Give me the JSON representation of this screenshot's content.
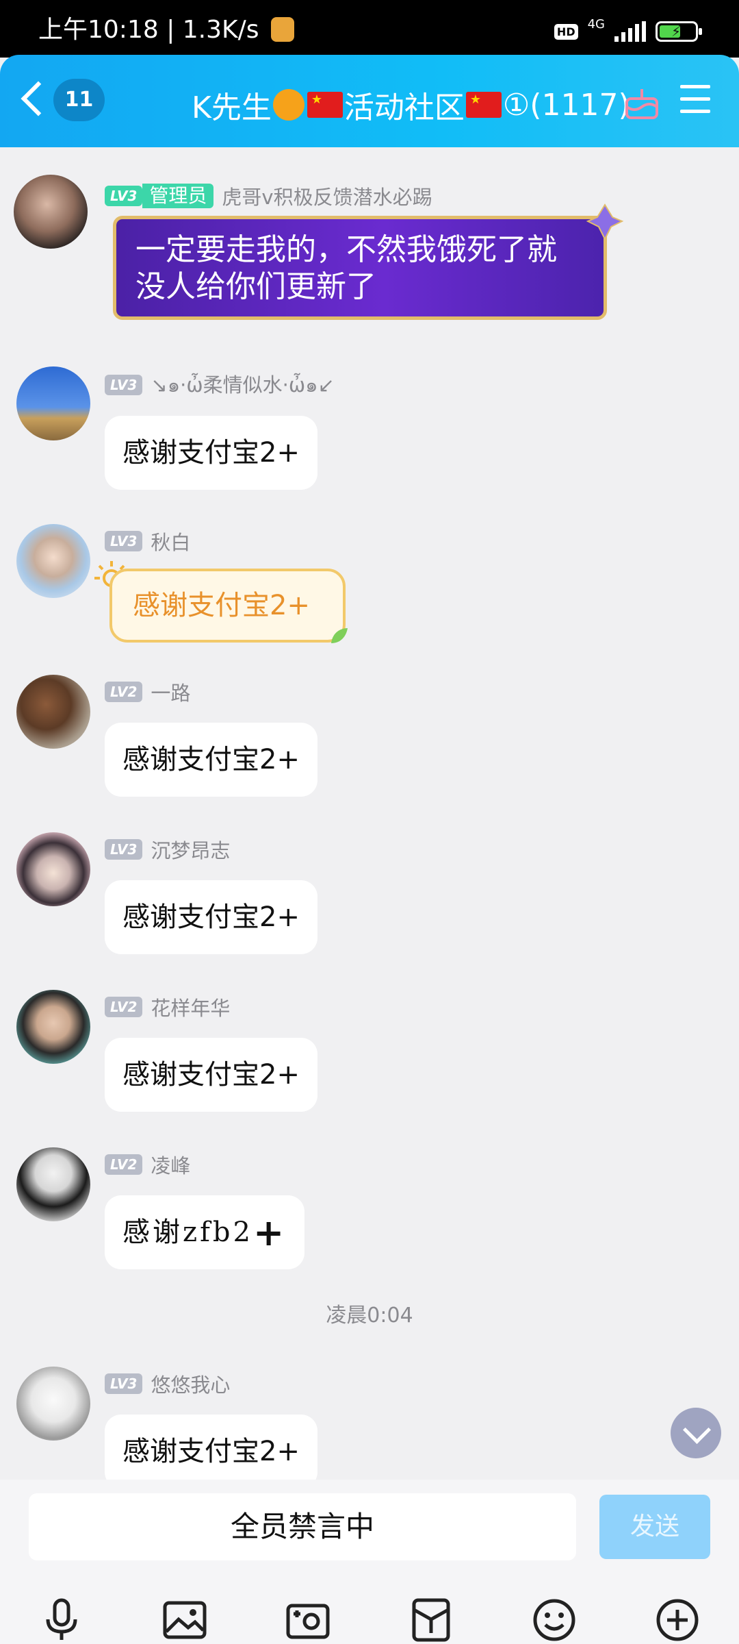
{
  "status_bar": {
    "time": "上午10:18",
    "speed": "1.3K/s",
    "hd": "HD",
    "network": "4G"
  },
  "header": {
    "unread_count": "11",
    "title_prefix": "K先生",
    "title_mid": "活动社区",
    "title_suffix": "①(1117)"
  },
  "messages": [
    {
      "level": "LV3",
      "role": "管理员",
      "nickname": "虎哥v积极反馈潜水必踢",
      "text_line1": "一定要走我的，不然我饿死了就",
      "text_line2": "没人给你们更新了"
    },
    {
      "level": "LV3",
      "nickname": "↘๑·ὦ柔情似水·ὦ๑↙",
      "text": "感谢支付宝2+"
    },
    {
      "level": "LV3",
      "nickname": "秋白",
      "text": "感谢支付宝2+"
    },
    {
      "level": "LV2",
      "nickname": "一路",
      "text": "感谢支付宝2+"
    },
    {
      "level": "LV3",
      "nickname": "沉梦昂志",
      "text": "感谢支付宝2+"
    },
    {
      "level": "LV2",
      "nickname": "花样年华",
      "text": "感谢支付宝2+"
    },
    {
      "level": "LV2",
      "nickname": "凌峰",
      "text": "感谢zfb2",
      "suffix": "+"
    },
    {
      "level": "LV3",
      "nickname": "悠悠我心",
      "text": "感谢支付宝2+"
    }
  ],
  "timestamp": "凌晨0:04",
  "input": {
    "muted_text": "全员禁言中",
    "send_label": "发送"
  },
  "colors": {
    "header": "#13a7f2",
    "admin_badge": "#3cd6a9",
    "send_disabled": "#8fd2fb"
  },
  "icons": [
    "microphone-icon",
    "image-icon",
    "camera-icon",
    "red-packet-icon",
    "emoji-icon",
    "plus-icon"
  ]
}
